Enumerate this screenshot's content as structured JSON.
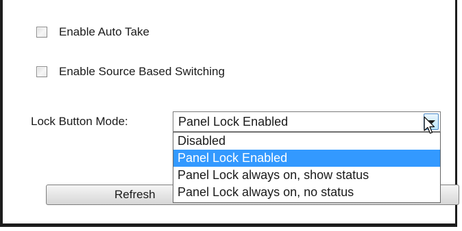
{
  "checkboxes": [
    {
      "label": "Enable Auto Take",
      "checked": false
    },
    {
      "label": "Enable Source Based Switching",
      "checked": false
    }
  ],
  "lock_mode": {
    "label": "Lock Button Mode:",
    "selected": "Panel Lock Enabled",
    "options": [
      "Disabled",
      "Panel Lock Enabled",
      "Panel Lock always on, show status",
      "Panel Lock always on, no status"
    ],
    "highlighted_index": 1
  },
  "refresh_label": "Refresh",
  "colors": {
    "highlight": "#3399ff",
    "frame": "#1c1c1c"
  },
  "icons": {
    "dropdown": "chevron-down-icon",
    "cursor": "mouse-pointer-icon"
  }
}
